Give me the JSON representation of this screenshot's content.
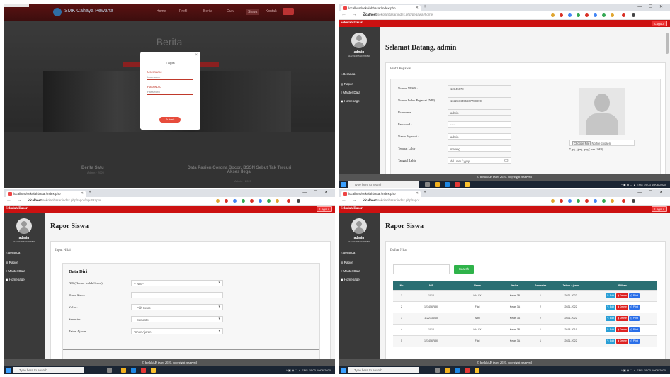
{
  "q1": {
    "brand": "SMK Cahaya Pewarta",
    "menu": [
      "Home",
      "Profil",
      "Berita",
      "Guru",
      "Siswa",
      "Kontak"
    ],
    "hero_heading": "Berita",
    "modal": {
      "close": "×",
      "title": "Login",
      "username_label": "Username",
      "username_placeholder": "Username",
      "password_label": "Password",
      "password_placeholder": "Password",
      "submit_label": "Submit"
    },
    "cards": [
      {
        "title": "Berita Satu",
        "sub": "Admin · 2020"
      },
      {
        "title": "Data Pasien Corona Bocor, BSSN Sebut Tak Tercuri Akses Ilegal",
        "sub": "Admin · 2020"
      }
    ]
  },
  "browser": {
    "tab_title": "localhost/sekolahbasar/index.php",
    "url_host": "localhost",
    "url_q2_path": "/sekolahbasar/index.php/pegawai/home",
    "url_q3_path": "/sekolahbasar/index.php/rapor/inputRapor",
    "url_q4_path": "/sekolahbasar/index.php/rapor",
    "window_controls": "— ☐ ✕",
    "new_tab": "+",
    "nav_buttons": "← → C"
  },
  "app": {
    "title": "Sekolah Dasar",
    "logout_label": "Logout",
    "user": "admin",
    "nip": "1122334455667788899",
    "sidebar_items": [
      "Beranda",
      "Rapor",
      "Master Data",
      "Homepage"
    ],
    "footer": "© boskhAB team 2020. copyright reserved"
  },
  "q2": {
    "welcome": "Selamat Datang, admin",
    "section": "Profil Pegawai",
    "fields": [
      {
        "label": "Nomor NPSN :",
        "value": "12345678"
      },
      {
        "label": "Nomor Induk Pegawai (NIP)",
        "value": "1122334455667788899"
      },
      {
        "label": "Username",
        "value": "admin"
      },
      {
        "label": "Password :",
        "value": "•••••"
      },
      {
        "label": "Nama Pegawai :",
        "value": "admin"
      },
      {
        "label": "Tempat Lahir",
        "value": "malang"
      },
      {
        "label": "Tanggal Lahir",
        "value": "dd / mm / yyyy"
      }
    ],
    "file_button": "Choose File",
    "file_none": "No file chosen",
    "file_hint": "*.jpg , .jpeg, .png ( max. 1MB)"
  },
  "q3": {
    "heading": "Rapor Siswa",
    "section": "Input Nilai",
    "subheading": "Data Diri",
    "fields": [
      {
        "label": "NIS (Nomor Induk Siswa)",
        "value": "-- NIS --",
        "select": true
      },
      {
        "label": "Nama Siswa :",
        "value": "",
        "select": false
      },
      {
        "label": "Kelas :",
        "value": "-- Pilih Kelas --",
        "select": true
      },
      {
        "label": "Semester",
        "value": "-- Semester --",
        "select": true
      },
      {
        "label": "Tahun Ajaran",
        "value": "Tahun Ajaran",
        "select": true
      }
    ]
  },
  "q4": {
    "heading": "Rapor Siswa",
    "section": "Daftar Nilai",
    "search_label": "Search",
    "columns": [
      "No",
      "NIS",
      "Nama",
      "Kelas",
      "Semester",
      "Tahun Ajaran",
      "Pilihan"
    ],
    "rows": [
      [
        "1",
        "1010",
        "bila 0X",
        "Kelas 3B",
        "1",
        "2021-2022"
      ],
      [
        "2",
        "1234567890",
        "Fikri",
        "Kelas 3A",
        "2",
        "2021-2022"
      ],
      [
        "3",
        "1122334455",
        "Akbil",
        "Kelas 3A",
        "2",
        "2021-2022"
      ],
      [
        "4",
        "1010",
        "bila 0X",
        "Kelas 3B",
        "1",
        "2018-2019"
      ],
      [
        "5",
        "1234567890",
        "Fikri",
        "Kelas 3A",
        "1",
        "2021-2022"
      ]
    ],
    "actions": {
      "edit": "Edit",
      "delete": "Delete",
      "print": "Print"
    }
  },
  "taskbar": {
    "search_placeholder": "Type here to search",
    "tray": "^ ▣ ◉ ☐ ▲ ENG 19:03 10/06/2020"
  },
  "colors": {
    "header": "#cc1111",
    "sidebar": "#3a3a3a",
    "table_header": "#2a6f73",
    "search_btn": "#2fb34a"
  }
}
